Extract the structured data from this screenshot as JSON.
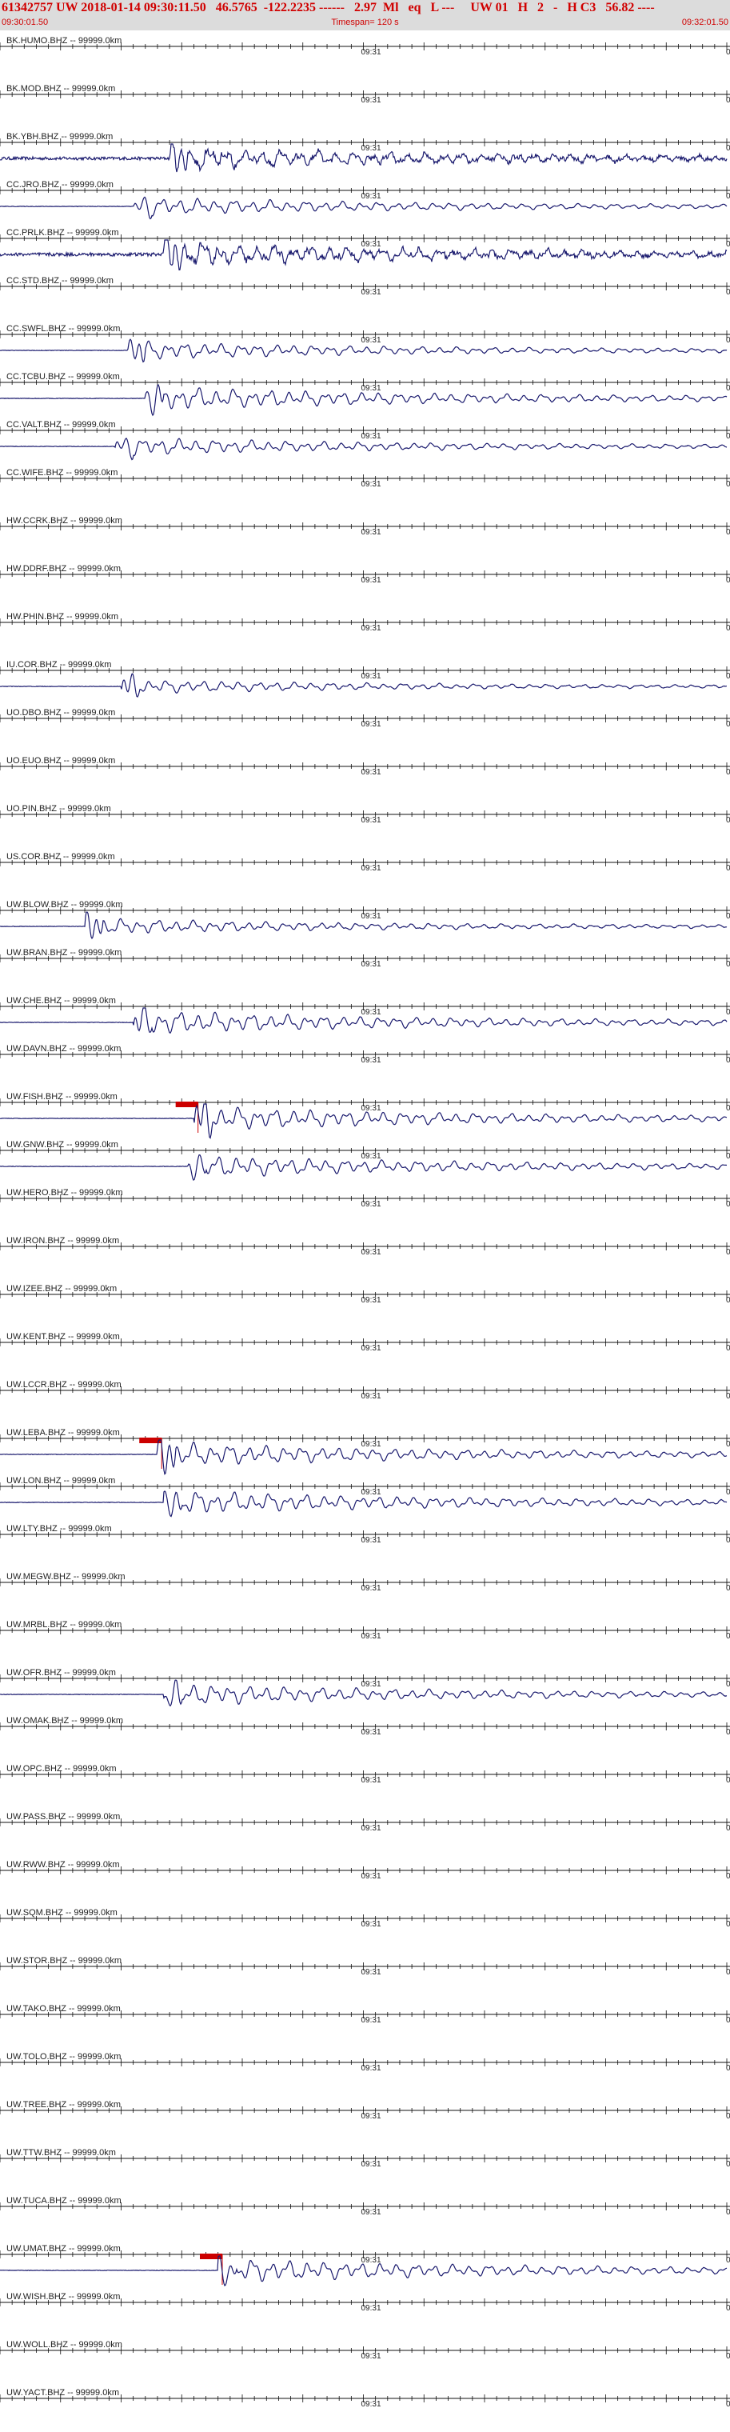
{
  "header": {
    "title_line": "61342757 UW 2018-01-14 09:30:11.50   46.5765  -122.2235 ------   2.97  Ml   eq   L ---     UW 01   H   2   -   H C3   56.82 ----",
    "start_time": "09:30:01.50",
    "timespan": "Timespan= 120 s",
    "end_time": "09:32:01.50"
  },
  "colors": {
    "trace": "#1a1a6e",
    "axis": "#111111",
    "pick": "#cc0000",
    "header_bg": "#dcdcdc",
    "header_text": "#d00000"
  },
  "chart_data": {
    "type": "line",
    "title": "61342757 UW 2018-01-14 09:30:11.50",
    "xlabel": "",
    "ylabel": "",
    "xlim": [
      "09:30:01.50",
      "09:32:01.50"
    ],
    "timespan_s": 120,
    "center_tick_label": "09:31",
    "right_edge_label": "0",
    "channels": [
      {
        "label": "BK.HUMO.BHZ -- 99999.0km",
        "trace": "none"
      },
      {
        "label": "BK.MOD.BHZ -- 99999.0km",
        "trace": "none"
      },
      {
        "label": "BK.YBH.BHZ -- 99999.0km",
        "trace": "noisy",
        "onset_s": 28,
        "amp": 0.55
      },
      {
        "label": "CC.JRO.BHZ -- 99999.0km",
        "trace": "smooth",
        "onset_s": 22,
        "amp": 0.45
      },
      {
        "label": "CC.PRLK.BHZ -- 99999.0km",
        "trace": "noisy",
        "onset_s": 27,
        "amp": 0.6
      },
      {
        "label": "CC.STD.BHZ -- 99999.0km",
        "trace": "none"
      },
      {
        "label": "CC.SWFL.BHZ -- 99999.0km",
        "trace": "smooth",
        "onset_s": 21,
        "amp": 0.45
      },
      {
        "label": "CC.TCBU.BHZ -- 99999.0km",
        "trace": "smooth",
        "onset_s": 24,
        "amp": 0.6
      },
      {
        "label": "CC.VALT.BHZ -- 99999.0km",
        "trace": "smooth",
        "onset_s": 19,
        "amp": 0.45
      },
      {
        "label": "CC.WIFE.BHZ -- 99999.0km",
        "trace": "none"
      },
      {
        "label": "HW.CCRK.BHZ -- 99999.0km",
        "trace": "none"
      },
      {
        "label": "HW.DDRF.BHZ -- 99999.0km",
        "trace": "none"
      },
      {
        "label": "HW.PHIN.BHZ -- 99999.0km",
        "trace": "none"
      },
      {
        "label": "IU.COR.BHZ -- 99999.0km",
        "trace": "smooth",
        "onset_s": 20,
        "amp": 0.35
      },
      {
        "label": "UO.DBO.BHZ -- 99999.0km",
        "trace": "none"
      },
      {
        "label": "UO.EUO.BHZ -- 99999.0km",
        "trace": "none"
      },
      {
        "label": "UO.PIN.BHZ -- 99999.0km",
        "trace": "none"
      },
      {
        "label": "US.COR.BHZ -- 99999.0km",
        "trace": "none"
      },
      {
        "label": "UW.BLOW.BHZ -- 99999.0km",
        "trace": "smooth",
        "onset_s": 14,
        "amp": 0.4
      },
      {
        "label": "UW.BRAN.BHZ -- 99999.0km",
        "trace": "none"
      },
      {
        "label": "UW.CHE.BHZ -- 99999.0km",
        "trace": "smooth",
        "onset_s": 22,
        "amp": 0.6
      },
      {
        "label": "UW.DAVN.BHZ -- 99999.0km",
        "trace": "none"
      },
      {
        "label": "UW.FISH.BHZ -- 99999.0km",
        "trace": "smooth",
        "onset_s": 32,
        "amp": 0.6,
        "pick_s": 29
      },
      {
        "label": "UW.GNW.BHZ -- 99999.0km",
        "trace": "smooth",
        "onset_s": 31,
        "amp": 0.55
      },
      {
        "label": "UW.HERO.BHZ -- 99999.0km",
        "trace": "none"
      },
      {
        "label": "UW.IRON.BHZ -- 99999.0km",
        "trace": "none"
      },
      {
        "label": "UW.IZEE.BHZ -- 99999.0km",
        "trace": "none"
      },
      {
        "label": "UW.KENT.BHZ -- 99999.0km",
        "trace": "none"
      },
      {
        "label": "UW.LCCR.BHZ -- 99999.0km",
        "trace": "none"
      },
      {
        "label": "UW.LEBA.BHZ -- 99999.0km",
        "trace": "smooth",
        "onset_s": 26,
        "amp": 0.6,
        "pick_s": 23
      },
      {
        "label": "UW.LON.BHZ -- 99999.0km",
        "trace": "smooth",
        "onset_s": 27,
        "amp": 0.6
      },
      {
        "label": "UW.LTY.BHZ -- 99999.0km",
        "trace": "none"
      },
      {
        "label": "UW.MEGW.BHZ -- 99999.0km",
        "trace": "none"
      },
      {
        "label": "UW.MRBL.BHZ -- 99999.0km",
        "trace": "none"
      },
      {
        "label": "UW.OFR.BHZ -- 99999.0km",
        "trace": "smooth",
        "onset_s": 27,
        "amp": 0.55
      },
      {
        "label": "UW.OMAK.BHZ -- 99999.0km",
        "trace": "none"
      },
      {
        "label": "UW.OPC.BHZ -- 99999.0km",
        "trace": "none"
      },
      {
        "label": "UW.PASS.BHZ -- 99999.0km",
        "trace": "none"
      },
      {
        "label": "UW.RWW.BHZ -- 99999.0km",
        "trace": "none"
      },
      {
        "label": "UW.SQM.BHZ -- 99999.0km",
        "trace": "none"
      },
      {
        "label": "UW.STOR.BHZ -- 99999.0km",
        "trace": "none"
      },
      {
        "label": "UW.TAKO.BHZ -- 99999.0km",
        "trace": "none"
      },
      {
        "label": "UW.TOLO.BHZ -- 99999.0km",
        "trace": "none"
      },
      {
        "label": "UW.TREE.BHZ -- 99999.0km",
        "trace": "none"
      },
      {
        "label": "UW.TTW.BHZ -- 99999.0km",
        "trace": "none"
      },
      {
        "label": "UW.TUCA.BHZ -- 99999.0km",
        "trace": "none"
      },
      {
        "label": "UW.UMAT.BHZ -- 99999.0km",
        "trace": "smooth",
        "onset_s": 36,
        "amp": 0.6,
        "pick_s": 33
      },
      {
        "label": "UW.WISH.BHZ -- 99999.0km",
        "trace": "none"
      },
      {
        "label": "UW.WOLL.BHZ -- 99999.0km",
        "trace": "none"
      },
      {
        "label": "UW.YACT.BHZ -- 99999.0km",
        "trace": "none"
      }
    ]
  }
}
